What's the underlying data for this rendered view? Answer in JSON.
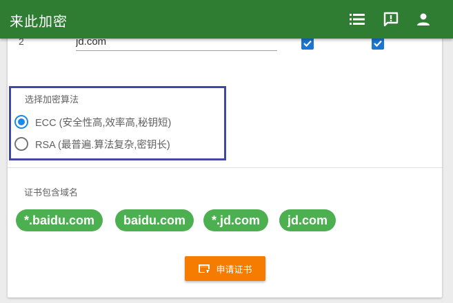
{
  "app": {
    "title": "来此加密"
  },
  "header_icons": [
    "list-icon",
    "feedback-icon",
    "account-icon"
  ],
  "domain_row": {
    "index": "2",
    "value": "jd.com",
    "checkbox1_checked": true,
    "checkbox2_checked": true
  },
  "algorithm": {
    "label": "选择加密算法",
    "options": [
      {
        "label": "ECC (安全性高,效率高,秘钥短)",
        "selected": true
      },
      {
        "label": "RSA (最普遍.算法复杂,密钥长)",
        "selected": false
      }
    ]
  },
  "certificate": {
    "label": "证书包含域名",
    "domains": [
      "*.baidu.com",
      "baidu.com",
      "*.jd.com",
      "jd.com"
    ]
  },
  "apply_button": {
    "label": "申请证书"
  },
  "colors": {
    "appbar": "#2e7d32",
    "chip": "#4caf50",
    "button": "#f57c00",
    "highlight_border": "#3f48a8",
    "radio_accent": "#1e88e5"
  }
}
